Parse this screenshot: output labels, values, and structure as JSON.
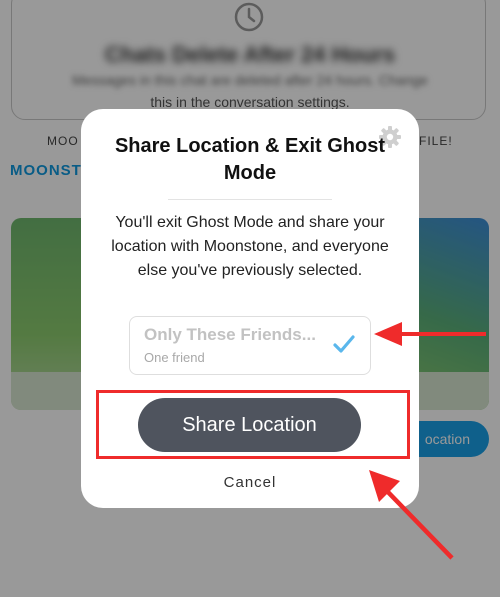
{
  "background": {
    "blurred_title": "Chats Delete After 24 Hours",
    "blurred_subtitle": "Messages in this chat are deleted after 24 hours. Change",
    "settings_text": "this in the conversation settings.",
    "left_caption": "MOO",
    "right_caption": "FILE!",
    "contact_name_partial": "MOONST",
    "location_button_partial": "ocation",
    "icons": {
      "timer": "clock-icon"
    },
    "colors": {
      "accent": "#0f9ae0",
      "button": "#1aa0e8"
    }
  },
  "modal": {
    "title": "Share Location & Exit Ghost Mode",
    "body": "You'll exit Ghost Mode and share your location with Moonstone, and everyone else you've previously selected.",
    "audience": {
      "title": "Only These Friends...",
      "subtitle": "One friend",
      "selected": true
    },
    "share_button": "Share Location",
    "cancel_button": "Cancel",
    "icons": {
      "settings": "gear-icon",
      "selected": "checkmark-icon"
    },
    "colors": {
      "share_button": "#4f545e",
      "check": "#5ab7ec"
    }
  },
  "annotations": {
    "highlight_color": "#ef2b2b"
  }
}
